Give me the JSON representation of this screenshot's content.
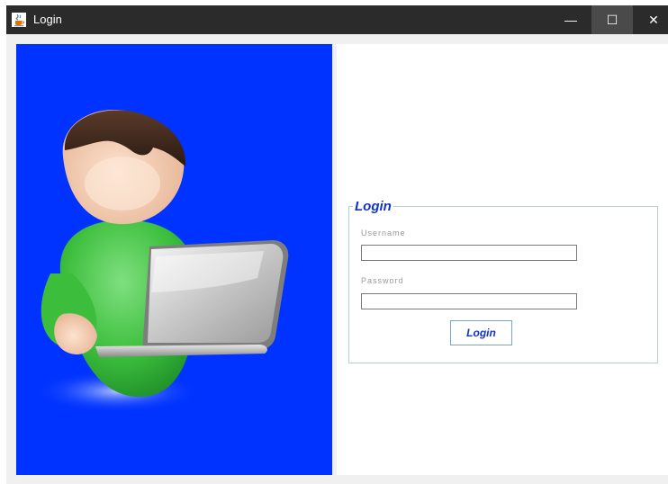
{
  "window": {
    "title": "Login",
    "title_icon": "java-cup-icon",
    "controls": {
      "minimize_glyph": "—",
      "maximize_glyph": "☐",
      "close_glyph": "✕"
    }
  },
  "illustration": {
    "icon": "user-with-laptop-icon",
    "background_color": "#0033ff"
  },
  "login_form": {
    "group_title": "Login",
    "username_label": "Username",
    "username_value": "",
    "password_label": "Password",
    "password_value": "",
    "submit_label": "Login"
  },
  "colors": {
    "accent_text": "#1133cc",
    "titlebar": "#2b2b2b"
  }
}
